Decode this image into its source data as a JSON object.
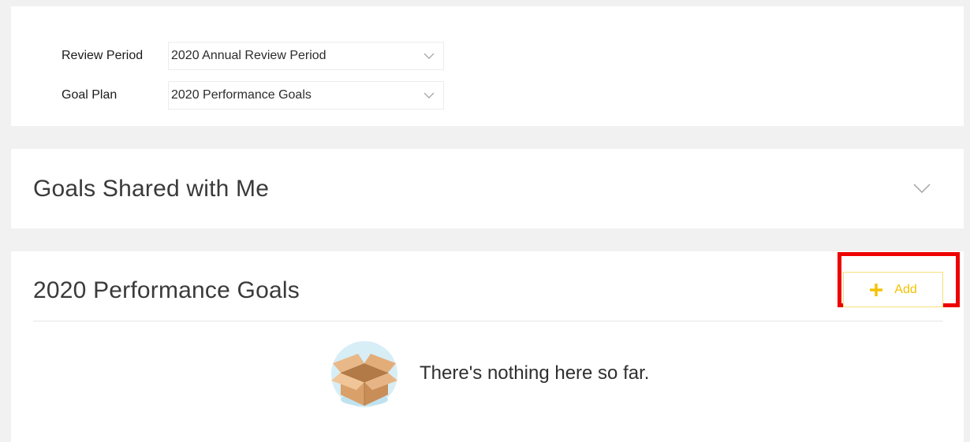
{
  "filters": {
    "review_period": {
      "label": "Review Period",
      "value": "2020 Annual Review Period"
    },
    "goal_plan": {
      "label": "Goal Plan",
      "value": "2020 Performance Goals"
    }
  },
  "shared_section": {
    "title": "Goals Shared with Me",
    "toggle_icon": "chevron-down-icon"
  },
  "goals_section": {
    "title": "2020 Performance Goals",
    "add_button": {
      "label": "Add",
      "icon": "plus-icon"
    },
    "empty_state": {
      "message": "There's nothing here so far.",
      "illustration": "open-box-icon"
    }
  },
  "colors": {
    "accent": "#f3c200",
    "highlight": "#ee0000",
    "page_background": "#f1f1f1",
    "panel_background": "#ffffff"
  }
}
